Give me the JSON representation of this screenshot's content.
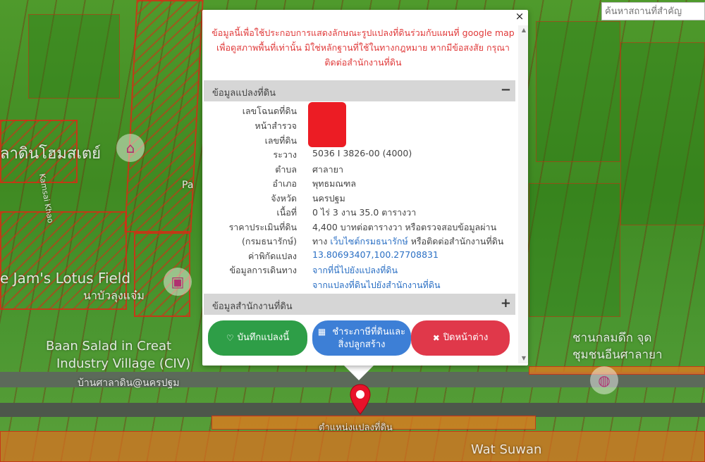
{
  "search": {
    "placeholder": "ค้นหาสถานที่สำคัญ"
  },
  "map_labels": {
    "homestay": "ลาดินโฮมสเตย์",
    "pa": "Pa",
    "kamsai": "Kamsai Khao",
    "lotus": "e Jam's Lotus Field",
    "lotus_th": "นาบัวลุงแจ๋ม",
    "baan_salad": "Baan Salad in Creat",
    "industry": "Industry Village (CIV)",
    "baan_th": "บ้านศาลาดิน@นครปฐม",
    "right_th1": "ชานกลมดึก จุด",
    "right_th2": "ชุมชนอีนศาลายา",
    "wat": "Wat Suwan",
    "pin_label": "ตำแหน่งแปลงที่ดิน"
  },
  "popup": {
    "close": "×",
    "disclaimer": "ข้อมูลนี้เพื่อใช้ประกอบการแสดงลักษณะรูปแปลงที่ดินร่วมกับแผนที่ google map เพื่อดูสภาพพื้นที่เท่านั้น มิใช่หลักฐานที่ใช้ในทางกฎหมาย หากมีข้อสงสัย กรุณาติดต่อสำนักงานที่ดิน",
    "section_land": "ข้อมูลแปลงที่ดิน",
    "section_land_toggle": "−",
    "section_office": "ข้อมูลสำนักงานที่ดิน",
    "section_office_toggle": "+",
    "rows": {
      "deed_no": {
        "k": "เลขโฉนดที่ดิน",
        "v": ""
      },
      "survey_page": {
        "k": "หน้าสำรวจ",
        "v": ""
      },
      "land_no": {
        "k": "เลขที่ดิน",
        "v": ""
      },
      "rawang": {
        "k": "ระวาง",
        "v": "5036 I 3826-00 (4000)"
      },
      "tambon": {
        "k": "ตำบล",
        "v": "ศาลายา"
      },
      "amphoe": {
        "k": "อำเภอ",
        "v": "พุทธมณฑล"
      },
      "province": {
        "k": "จังหวัด",
        "v": "นครปฐม"
      },
      "area": {
        "k": "เนื้อที่",
        "v": "0 ไร่ 3 งาน 35.0 ตารางวา"
      },
      "price": {
        "k": "ราคาประเมินที่ดิน",
        "v": "4,400 บาทต่อตารางวา หรือตรวจสอบข้อมูลผ่าน"
      },
      "dept": {
        "k": "(กรมธนารักษ์)",
        "v_pre": "ทาง",
        "v_link": "เว็บไซต์กรมธนารักษ์",
        "v_post": "หรือติดต่อสำนักงานที่ดิน"
      },
      "coords": {
        "k": "ค่าพิกัดแปลง",
        "v": "13.80693407,100.27708831"
      },
      "travel": {
        "k": "ข้อมูลการเดินทาง",
        "v1": "จากที่นี่ไปยังแปลงที่ดิน",
        "v2": "จากแปลงที่ดินไปยังสำนักงานที่ดิน"
      }
    },
    "buttons": {
      "save": "บันทึกแปลงนี้",
      "tax_line1": "ชำระภาษีที่ดินและ",
      "tax_line2": "สิ่งปลูกสร้าง",
      "close": "ปิดหน้าต่าง"
    }
  },
  "colors": {
    "disclaimer": "#e03a3a",
    "link": "#2a6fc4",
    "save": "#2e9e47",
    "tax": "#3d7fd6",
    "close": "#e0384a",
    "redaction": "#ec1c24"
  }
}
